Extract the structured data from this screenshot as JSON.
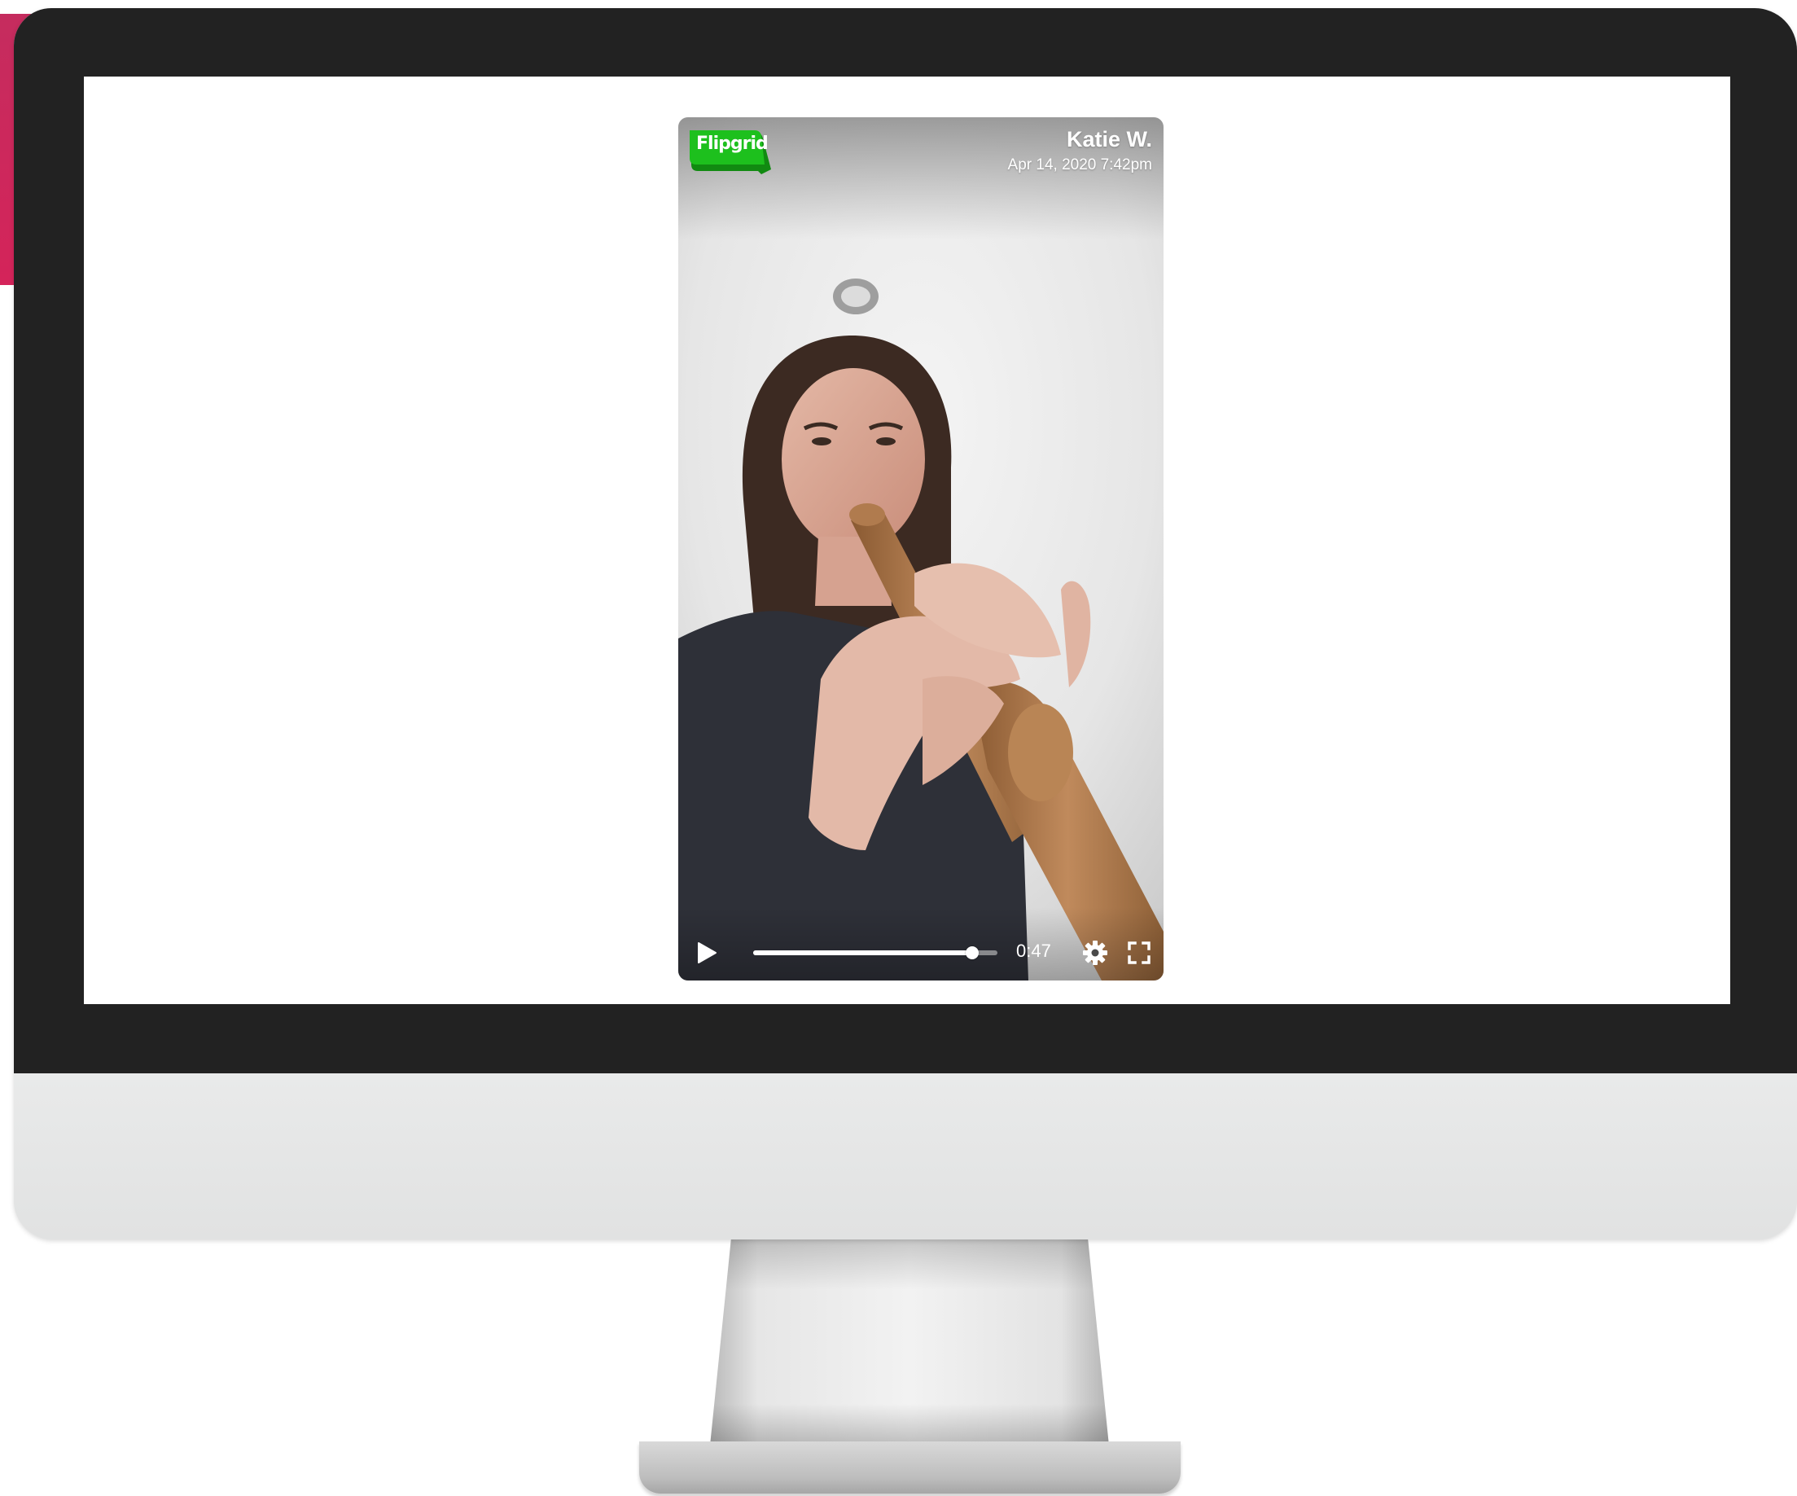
{
  "video": {
    "brand": "Flipgrid",
    "author": "Katie W.",
    "date": "Apr 14, 2020 7:42pm",
    "duration": "0:47",
    "progress": 0.895,
    "brand_color": "#1dc01d"
  },
  "controls": {
    "play_icon": "play-icon",
    "settings_icon": "gear-icon",
    "fullscreen_icon": "fullscreen-icon"
  },
  "colors": {
    "accent_tab": "#c52c5e",
    "bezel": "#222222",
    "chin": "#e5e6e6"
  }
}
